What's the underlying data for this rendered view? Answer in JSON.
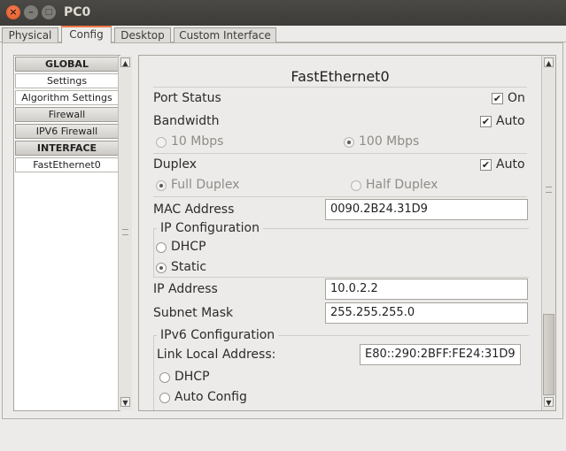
{
  "window": {
    "title": "PC0",
    "close_glyph": "×",
    "min_glyph": "–",
    "max_glyph": "□"
  },
  "tabs": [
    {
      "label": "Physical"
    },
    {
      "label": "Config"
    },
    {
      "label": "Desktop"
    },
    {
      "label": "Custom Interface"
    }
  ],
  "sidebar": {
    "items": [
      {
        "label": "GLOBAL"
      },
      {
        "label": "Settings"
      },
      {
        "label": "Algorithm Settings"
      },
      {
        "label": "Firewall"
      },
      {
        "label": "IPV6 Firewall"
      },
      {
        "label": "INTERFACE"
      },
      {
        "label": "FastEthernet0"
      }
    ]
  },
  "scroll": {
    "up": "▲",
    "down": "▼"
  },
  "panel": {
    "title": "FastEthernet0",
    "port_status": {
      "label": "Port Status",
      "check": "✔",
      "value": "On"
    },
    "bandwidth": {
      "label": "Bandwidth",
      "check": "✔",
      "auto_label": "Auto",
      "opt_10": "10 Mbps",
      "opt_100": "100 Mbps"
    },
    "duplex": {
      "label": "Duplex",
      "check": "✔",
      "auto_label": "Auto",
      "full": "Full Duplex",
      "half": "Half Duplex"
    },
    "mac": {
      "label": "MAC Address",
      "value": "0090.2B24.31D9"
    },
    "ip_config": {
      "title": "IP Configuration",
      "dhcp": "DHCP",
      "static": "Static"
    },
    "ip_address": {
      "label": "IP Address",
      "value": "10.0.2.2"
    },
    "subnet": {
      "label": "Subnet Mask",
      "value": "255.255.255.0"
    },
    "ipv6_config": {
      "title": "IPv6 Configuration",
      "link_local_label": "Link Local Address:",
      "link_local_value": "E80::290:2BFF:FE24:31D9",
      "dhcp": "DHCP",
      "auto": "Auto Config"
    }
  }
}
